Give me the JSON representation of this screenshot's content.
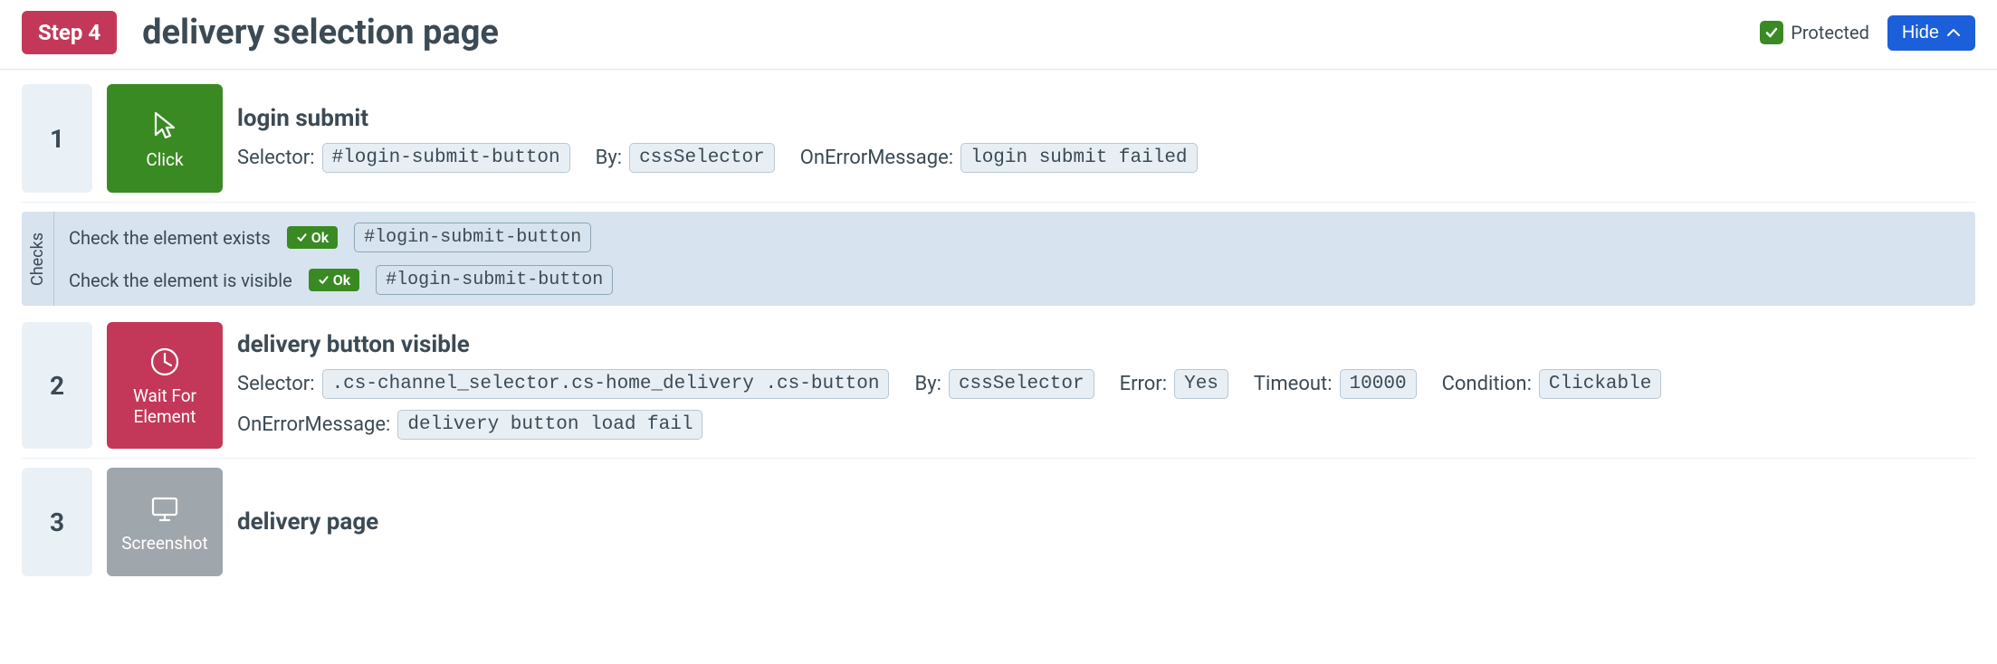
{
  "header": {
    "step_badge": "Step 4",
    "title": "delivery selection page",
    "protected_label": "Protected",
    "hide_label": "Hide"
  },
  "actions": [
    {
      "num": "1",
      "tile": {
        "type": "click",
        "label": "Click"
      },
      "name": "login submit",
      "params": [
        {
          "label": "Selector:",
          "value": "#login-submit-button"
        },
        {
          "label": "By:",
          "value": "cssSelector"
        },
        {
          "label": "OnErrorMessage:",
          "value": "login submit failed"
        }
      ],
      "checks": [
        {
          "text": "Check the element exists",
          "status": "Ok",
          "value": "#login-submit-button"
        },
        {
          "text": "Check the element is visible",
          "status": "Ok",
          "value": "#login-submit-button"
        }
      ]
    },
    {
      "num": "2",
      "tile": {
        "type": "wait",
        "label": "Wait For Element"
      },
      "name": "delivery button visible",
      "param_lines": [
        [
          {
            "label": "Selector:",
            "value": ".cs-channel_selector.cs-home_delivery .cs-button"
          },
          {
            "label": "By:",
            "value": "cssSelector"
          },
          {
            "label": "Error:",
            "value": "Yes"
          },
          {
            "label": "Timeout:",
            "value": "10000"
          },
          {
            "label": "Condition:",
            "value": "Clickable"
          }
        ],
        [
          {
            "label": "OnErrorMessage:",
            "value": "delivery button load fail"
          }
        ]
      ]
    },
    {
      "num": "3",
      "tile": {
        "type": "screenshot",
        "label": "Screenshot"
      },
      "name": "delivery page"
    }
  ],
  "labels": {
    "checks_sidebar": "Checks"
  }
}
